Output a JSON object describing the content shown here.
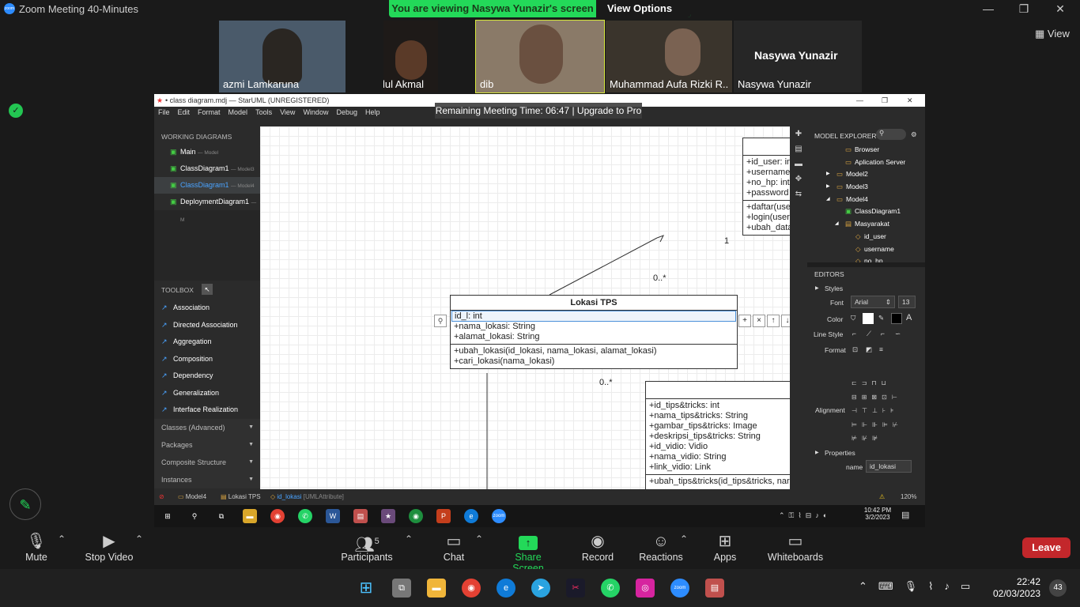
{
  "zoom": {
    "window_title": "Zoom Meeting 40-Minutes",
    "logo_text": "zoom",
    "banner_message": "You are viewing Nasywa Yunazir's screen",
    "view_options": "View Options",
    "view_button": "View",
    "big_name": "Nasywa Yunazir",
    "participants": [
      {
        "name": "azmi Lamkaruna"
      },
      {
        "name": "m.afzalul Akmal"
      },
      {
        "name": "dib"
      },
      {
        "name": "Muhammad Aufa Rizki R..."
      },
      {
        "name": "Nasywa Yunazir"
      }
    ],
    "toolbar": {
      "mute": "Mute",
      "stop_video": "Stop Video",
      "participants": "Participants",
      "participants_count": "5",
      "chat": "Chat",
      "share_screen": "Share Screen",
      "record": "Record",
      "reactions": "Reactions",
      "apps": "Apps",
      "whiteboards": "Whiteboards",
      "leave": "Leave"
    },
    "colors": {
      "share_green": "#23d959",
      "leave_red": "#c3272b"
    }
  },
  "staruml": {
    "title": "• class diagram.mdj — StarUML (UNREGISTERED)",
    "menu": [
      "File",
      "Edit",
      "Format",
      "Model",
      "Tools",
      "View",
      "Window",
      "Debug",
      "Help"
    ],
    "remaining": "Remaining Meeting Time: 06:47 | Upgrade to Pro",
    "working_diagrams_label": "WORKING DIAGRAMS",
    "working_diagrams": [
      {
        "name": "Main",
        "sub": "— Model"
      },
      {
        "name": "ClassDiagram1",
        "sub": "— Model3"
      },
      {
        "name": "ClassDiagram1",
        "sub": "— Model4"
      },
      {
        "name": "DeploymentDiagram1",
        "sub": "— M"
      }
    ],
    "toolbox_label": "TOOLBOX",
    "toolbox": [
      "Association",
      "Directed Association",
      "Aggregation",
      "Composition",
      "Dependency",
      "Generalization",
      "Interface Realization"
    ],
    "toolbox_cats": [
      "Classes (Advanced)",
      "Packages",
      "Composite Structure",
      "Instances"
    ],
    "diagram": {
      "user_attrs": [
        "+id_user: in",
        "+username",
        "+no_hp: int",
        "+password"
      ],
      "user_ops": [
        "+daftar(use",
        "+login(user",
        "+ubah_data"
      ],
      "mult_1": "1",
      "mult_many": "0..*",
      "mult_many2": "0..*",
      "lokasi_title": "Lokasi TPS",
      "lokasi_editing": "id_l: int",
      "lokasi_attrs": [
        "+nama_lokasi: String",
        "+alamat_lokasi: String"
      ],
      "lokasi_ops": [
        "+ubah_lokasi(id_lokasi, nama_lokasi, alamat_lokasi)",
        "+cari_lokasi(nama_lokasi)"
      ],
      "tips_attrs": [
        "+id_tips&tricks: int",
        "+nama_tips&tricks: String",
        "+gambar_tips&tricks: Image",
        "+deskripsi_tips&tricks: String",
        "+id_vidio: Vidio",
        "+nama_vidio: String",
        "+link_vidio: Link"
      ],
      "tips_ops": [
        "+ubah_tips&tricks(id_tips&tricks, nar"
      ]
    },
    "model_explorer_label": "MODEL EXPLORER",
    "model_explorer": [
      {
        "label": "Browser",
        "indent": 4
      },
      {
        "label": "Aplication Server",
        "indent": 4
      },
      {
        "label": "Model2",
        "indent": 2
      },
      {
        "label": "Model3",
        "indent": 2
      },
      {
        "label": "Model4",
        "indent": 2
      },
      {
        "label": "ClassDiagram1",
        "indent": 3
      },
      {
        "label": "Masyarakat",
        "indent": 3
      },
      {
        "label": "id_user",
        "indent": 5
      },
      {
        "label": "username",
        "indent": 5
      },
      {
        "label": "no_hp",
        "indent": 5
      }
    ],
    "editors_label": "EDITORS",
    "styles_label": "Styles",
    "font_label": "Font",
    "font_value": "Arial",
    "font_size": "13",
    "color_label": "Color",
    "line_style_label": "Line Style",
    "format_label": "Format",
    "alignment_label": "Alignment",
    "properties_label": "Properties",
    "name_label": "name",
    "name_value": "id_lokasi",
    "status_path": [
      "Model4",
      "Lokasi TPS",
      "id_lokasi"
    ],
    "status_type": "[UMLAttribute]",
    "zoom_level": "120%"
  },
  "win10": {
    "time": "10:42 PM",
    "date": "3/2/2023",
    "notif": "5"
  },
  "win11": {
    "time": "22:42",
    "date": "02/03/2023",
    "badge": "43"
  }
}
